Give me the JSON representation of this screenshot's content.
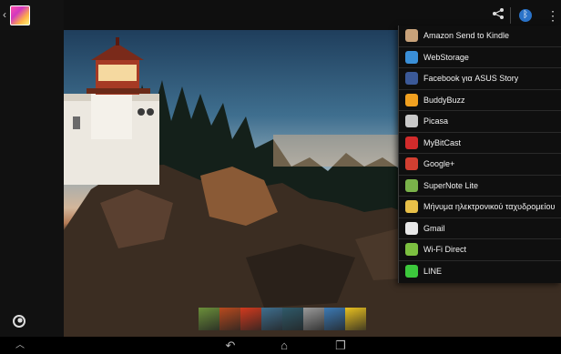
{
  "top_bar": {
    "back_glyph": "‹",
    "app_icon": "gallery-app-icon",
    "share_glyph": "⋖",
    "bluetooth_glyph": "ᛒ",
    "overflow_glyph": "⋮"
  },
  "share_menu": {
    "items": [
      {
        "label": "Amazon Send to Kindle",
        "icon": "kindle-icon",
        "color": "#c8a27a"
      },
      {
        "label": "WebStorage",
        "icon": "webstorage-icon",
        "color": "#3a8fd8"
      },
      {
        "label": "Facebook για ASUS Story",
        "icon": "facebook-story-icon",
        "color": "#3b5998"
      },
      {
        "label": "BuddyBuzz",
        "icon": "buddybuzz-icon",
        "color": "#f0a020"
      },
      {
        "label": "Picasa",
        "icon": "picasa-icon",
        "color": "#c9c9c9"
      },
      {
        "label": "MyBitCast",
        "icon": "mybitcast-icon",
        "color": "#d22b2b"
      },
      {
        "label": "Google+",
        "icon": "google-plus-icon",
        "color": "#d23f31"
      },
      {
        "label": "SuperNote Lite",
        "icon": "supernote-icon",
        "color": "#7ab24a"
      },
      {
        "label": "Μήνυμα ηλεκτρονικού ταχυδρομείου",
        "icon": "email-icon",
        "color": "#e8c048"
      },
      {
        "label": "Gmail",
        "icon": "gmail-icon",
        "color": "#e8e8e8"
      },
      {
        "label": "Wi-Fi Direct",
        "icon": "wifi-direct-icon",
        "color": "#7cc040"
      },
      {
        "label": "LINE",
        "icon": "line-icon",
        "color": "#3cc83c"
      }
    ]
  },
  "filmstrip": {
    "thumbs": [
      {
        "name": "thumb-1",
        "color": "#6b8f3a"
      },
      {
        "name": "thumb-2",
        "color": "#b84a1e"
      },
      {
        "name": "thumb-3",
        "color": "#d23a1e"
      },
      {
        "name": "thumb-4",
        "color": "#3f6f8f"
      },
      {
        "name": "thumb-5",
        "color": "#2f5a6a"
      },
      {
        "name": "thumb-6",
        "color": "#9a9a9a"
      },
      {
        "name": "thumb-7",
        "color": "#3c7ab5"
      },
      {
        "name": "thumb-8",
        "color": "#e8c020"
      }
    ]
  },
  "navbar": {
    "up_glyph": "︿",
    "back_glyph": "↶",
    "home_glyph": "⌂",
    "recent_glyph": "❐"
  }
}
